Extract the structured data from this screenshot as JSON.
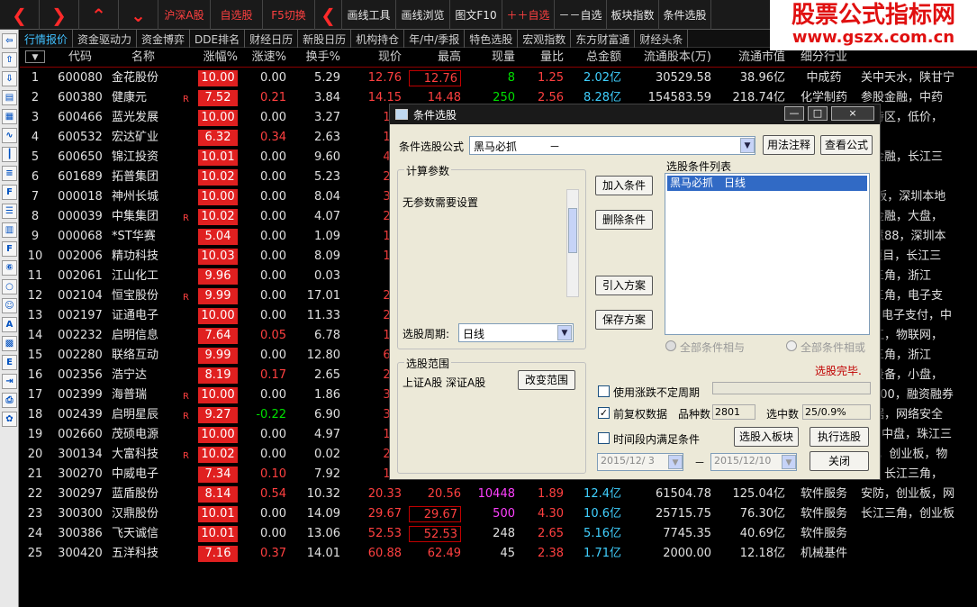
{
  "toolbar": {
    "buttons": [
      "沪深A股",
      "自选股",
      "F5切换",
      "画线工具",
      "画线浏览",
      "图文F10",
      "＋＋自选",
      "－－自选",
      "板块指数",
      "条件选股"
    ]
  },
  "logo": {
    "title": "股票公式指标网",
    "url": "www.gszx.com.cn"
  },
  "tabs": [
    "行情报价",
    "资金驱动力",
    "资金博弈",
    "DDE排名",
    "财经日历",
    "新股日历",
    "机构持仓",
    "年/中/季报",
    "特色选股",
    "宏观指数",
    "东方财富通",
    "财经头条"
  ],
  "sidebar": {
    "icons": [
      "left-arrow-icon",
      "up-arrow-icon",
      "down-arrow-icon",
      "report-icon",
      "table-icon",
      "line-chart-icon",
      "candle-icon",
      "text-icon",
      "f10-icon",
      "list-icon",
      "book-icon",
      "f12-icon",
      "f6-icon",
      "circle-icon",
      "person-icon",
      "a-icon",
      "grid-icon",
      "etf-icon",
      "import-icon",
      "printer-icon",
      "settings-icon"
    ]
  },
  "table": {
    "headers": [
      "",
      "代码",
      "名称",
      "涨幅%",
      "涨速%",
      "换手%",
      "现价",
      "最高",
      "现量",
      "量比",
      "总金额",
      "流通股本(万)",
      "流通市值",
      "细分行业",
      ""
    ],
    "rows": [
      {
        "i": "1",
        "code": "600080",
        "name": "金花股份",
        "flag": "",
        "pct": "10.00",
        "speed": "0.00",
        "turn": "5.29",
        "price": "12.76",
        "high": "12.76",
        "vol": "8",
        "ratio": "1.25",
        "amt": "2.02亿",
        "shares": "30529.58",
        "mcap": "38.96亿",
        "ind": "中成药",
        "extra": "关中天水，陕甘宁"
      },
      {
        "i": "2",
        "code": "600380",
        "name": "健康元",
        "flag": "R",
        "pct": "7.52",
        "speed": "0.21",
        "turn": "3.84",
        "price": "14.15",
        "high": "14.48",
        "vol": "250",
        "ratio": "2.56",
        "amt": "8.28亿",
        "shares": "154583.59",
        "mcap": "218.74亿",
        "ind": "化学制药",
        "extra": "参股金融，中药"
      },
      {
        "i": "3",
        "code": "600466",
        "name": "蓝光发展",
        "flag": "",
        "pct": "10.00",
        "speed": "0.00",
        "turn": "3.27",
        "price": "14.",
        "high": "",
        "vol": "",
        "ratio": "",
        "amt": "",
        "shares": "",
        "mcap": "",
        "ind": "",
        "extra": "渝特区，低价，"
      },
      {
        "i": "4",
        "code": "600532",
        "name": "宏达矿业",
        "flag": "",
        "pct": "6.32",
        "speed": "0.34",
        "turn": "2.63",
        "price": "17.",
        "high": "",
        "vol": "",
        "ratio": "",
        "amt": "",
        "shares": "",
        "mcap": "",
        "ind": "",
        "extra": ""
      },
      {
        "i": "5",
        "code": "600650",
        "name": "锦江投资",
        "flag": "",
        "pct": "10.01",
        "speed": "0.00",
        "turn": "9.60",
        "price": "41.",
        "high": "",
        "vol": "",
        "ratio": "",
        "amt": "",
        "shares": "",
        "mcap": "",
        "ind": "",
        "extra": "股金融，长江三"
      },
      {
        "i": "6",
        "code": "601689",
        "name": "拓普集团",
        "flag": "",
        "pct": "10.02",
        "speed": "0.00",
        "turn": "5.23",
        "price": "24.",
        "high": "",
        "vol": "",
        "ratio": "",
        "amt": "",
        "shares": "",
        "mcap": "",
        "ind": "",
        "extra": ""
      },
      {
        "i": "7",
        "code": "000018",
        "name": "神州长城",
        "flag": "",
        "pct": "10.00",
        "speed": "0.00",
        "turn": "8.04",
        "price": "32.",
        "high": "",
        "vol": "",
        "ratio": "",
        "amt": "",
        "shares": "",
        "mcap": "",
        "ind": "",
        "extra": "ST板，深圳本地"
      },
      {
        "i": "8",
        "code": "000039",
        "name": "中集集团",
        "flag": "R",
        "pct": "10.02",
        "speed": "0.00",
        "turn": "4.07",
        "price": "21.",
        "high": "",
        "vol": "",
        "ratio": "",
        "amt": "",
        "shares": "",
        "mcap": "",
        "ind": "",
        "extra": "股金融，大盘，"
      },
      {
        "i": "9",
        "code": "000068",
        "name": "*ST华赛",
        "flag": "",
        "pct": "5.04",
        "speed": "0.00",
        "turn": "1.09",
        "price": "11.",
        "high": "",
        "vol": "",
        "ratio": "",
        "amt": "",
        "shares": "",
        "mcap": "",
        "ind": "",
        "extra": "智慧88，深圳本"
      },
      {
        "i": "10",
        "code": "002006",
        "name": "精功科技",
        "flag": "",
        "pct": "10.03",
        "speed": "0.00",
        "turn": "8.09",
        "price": "14.",
        "high": "",
        "vol": "",
        "ratio": "",
        "amt": "",
        "shares": "",
        "mcap": "",
        "ind": "",
        "extra": "M项目，长江三"
      },
      {
        "i": "11",
        "code": "002061",
        "name": "江山化工",
        "flag": "",
        "pct": "9.96",
        "speed": "0.00",
        "turn": "0.03",
        "price": "7.",
        "high": "",
        "vol": "",
        "ratio": "",
        "amt": "",
        "shares": "",
        "mcap": "",
        "ind": "",
        "extra": "江三角，浙江"
      },
      {
        "i": "12",
        "code": "002104",
        "name": "恒宝股份",
        "flag": "R",
        "pct": "9.99",
        "speed": "0.00",
        "turn": "17.01",
        "price": "22.",
        "high": "",
        "vol": "",
        "ratio": "",
        "amt": "",
        "shares": "",
        "mcap": "",
        "ind": "",
        "extra": "江三角，电子支"
      },
      {
        "i": "13",
        "code": "002197",
        "name": "证通电子",
        "flag": "",
        "pct": "10.00",
        "speed": "0.00",
        "turn": "11.33",
        "price": "26.",
        "high": "",
        "vol": "",
        "ratio": "",
        "amt": "",
        "shares": "",
        "mcap": "",
        "ind": "",
        "extra": "D，电子支付，中"
      },
      {
        "i": "14",
        "code": "002232",
        "name": "启明信息",
        "flag": "",
        "pct": "7.64",
        "speed": "0.05",
        "turn": "6.78",
        "price": "16.",
        "high": "",
        "vol": "",
        "ratio": "",
        "amt": "",
        "shares": "",
        "mcap": "",
        "ind": "",
        "extra": "门江，物联网，"
      },
      {
        "i": "15",
        "code": "002280",
        "name": "联络互动",
        "flag": "",
        "pct": "9.99",
        "speed": "0.00",
        "turn": "12.80",
        "price": "62.",
        "high": "",
        "vol": "",
        "ratio": "",
        "amt": "",
        "shares": "",
        "mcap": "",
        "ind": "",
        "extra": "江三角，浙江"
      },
      {
        "i": "16",
        "code": "002356",
        "name": "浩宁达",
        "flag": "",
        "pct": "8.19",
        "speed": "0.17",
        "turn": "2.65",
        "price": "27.",
        "high": "",
        "vol": "",
        "ratio": "",
        "amt": "",
        "shares": "",
        "mcap": "",
        "ind": "",
        "extra": "力设备，小盘，"
      },
      {
        "i": "17",
        "code": "002399",
        "name": "海普瑞",
        "flag": "R",
        "pct": "10.00",
        "speed": "0.00",
        "turn": "1.86",
        "price": "33.",
        "high": "",
        "vol": "",
        "ratio": "",
        "amt": "",
        "shares": "",
        "mcap": "",
        "ind": "",
        "extra": "深300，融资融券"
      },
      {
        "i": "18",
        "code": "002439",
        "name": "启明星辰",
        "flag": "R",
        "pct": "9.27",
        "speed": "-0.22",
        "turn": "6.90",
        "price": "34.",
        "high": "",
        "vol": "",
        "ratio": "",
        "amt": "",
        "shares": "",
        "mcap": "",
        "ind": "",
        "extra": "数据，网络安全"
      },
      {
        "i": "19",
        "code": "002660",
        "name": "茂硕电源",
        "flag": "",
        "pct": "10.00",
        "speed": "0.00",
        "turn": "4.97",
        "price": "15.",
        "high": "",
        "vol": "",
        "ratio": "",
        "amt": "",
        "shares": "",
        "mcap": "",
        "ind": "",
        "extra": "D，中盘，珠江三"
      },
      {
        "i": "20",
        "code": "300134",
        "name": "大富科技",
        "flag": "R",
        "pct": "10.02",
        "speed": "0.00",
        "turn": "0.02",
        "price": "27.",
        "high": "",
        "vol": "",
        "ratio": "",
        "amt": "",
        "shares": "",
        "mcap": "",
        "ind": "",
        "extra": "5G，创业板，物"
      },
      {
        "i": "21",
        "code": "300270",
        "name": "中威电子",
        "flag": "",
        "pct": "7.34",
        "speed": "0.10",
        "turn": "7.92",
        "price": "19.",
        "high": "",
        "vol": "",
        "ratio": "",
        "amt": "",
        "shares": "",
        "mcap": "",
        "ind": "",
        "extra": "防，长江三角，"
      },
      {
        "i": "22",
        "code": "300297",
        "name": "蓝盾股份",
        "flag": "",
        "pct": "8.14",
        "speed": "0.54",
        "turn": "10.32",
        "price": "20.33",
        "high": "20.56",
        "vol": "10448",
        "ratio": "1.89",
        "amt": "12.4亿",
        "shares": "61504.78",
        "mcap": "125.04亿",
        "ind": "软件服务",
        "extra": "安防，创业板，网"
      },
      {
        "i": "23",
        "code": "300300",
        "name": "汉鼎股份",
        "flag": "",
        "pct": "10.01",
        "speed": "0.00",
        "turn": "14.09",
        "price": "29.67",
        "high": "29.67",
        "vol": "500",
        "ratio": "4.30",
        "amt": "10.6亿",
        "shares": "25715.75",
        "mcap": "76.30亿",
        "ind": "软件服务",
        "extra": "长江三角，创业板"
      },
      {
        "i": "24",
        "code": "300386",
        "name": "飞天诚信",
        "flag": "",
        "pct": "10.01",
        "speed": "0.00",
        "turn": "13.06",
        "price": "52.53",
        "high": "52.53",
        "vol": "248",
        "ratio": "2.65",
        "amt": "5.16亿",
        "shares": "7745.35",
        "mcap": "40.69亿",
        "ind": "软件服务",
        "extra": ""
      },
      {
        "i": "25",
        "code": "300420",
        "name": "五洋科技",
        "flag": "",
        "pct": "7.16",
        "speed": "0.37",
        "turn": "14.01",
        "price": "60.88",
        "high": "62.49",
        "vol": "45",
        "ratio": "2.38",
        "amt": "1.71亿",
        "shares": "2000.00",
        "mcap": "12.18亿",
        "ind": "机械基件",
        "extra": ""
      }
    ]
  },
  "dialog": {
    "title": "条件选股",
    "formula_label": "条件选股公式",
    "formula_value": "黑马必抓　　　－",
    "btn_usage": "用法注释",
    "btn_view": "查看公式",
    "params_title": "计算参数",
    "params_text": "无参数需要设置",
    "btn_add": "加入条件",
    "btn_delete": "删除条件",
    "btn_import": "引入方案",
    "btn_save": "保存方案",
    "list_title": "选股条件列表",
    "list_items": [
      "黑马必抓　日线"
    ],
    "period_label": "选股周期:",
    "period_value": "日线",
    "radio_and": "全部条件相与",
    "radio_or": "全部条件相或",
    "status": "选股完毕.",
    "range_title": "选股范围",
    "range_text": "上证A股 深证A股",
    "btn_range": "改变范围",
    "chk_limit": "使用涨跌不定周期",
    "chk_restore": "前复权数据",
    "kinds_label": "品种数",
    "kinds_value": "2801",
    "selected_label": "选中数",
    "selected_value": "25/0.9%",
    "chk_time": "时间段内满足条件",
    "btn_block": "选股入板块",
    "btn_exec": "执行选股",
    "date_from": "2015/12/ 3",
    "date_sep": "－",
    "date_to": "2015/12/10",
    "btn_close": "关闭",
    "win_min": "—",
    "win_max": "□",
    "win_close": "×"
  },
  "colors": {
    "up": "#ff4040",
    "down": "#00e000",
    "highlight": "#e02020",
    "info": "#40d0ff"
  }
}
